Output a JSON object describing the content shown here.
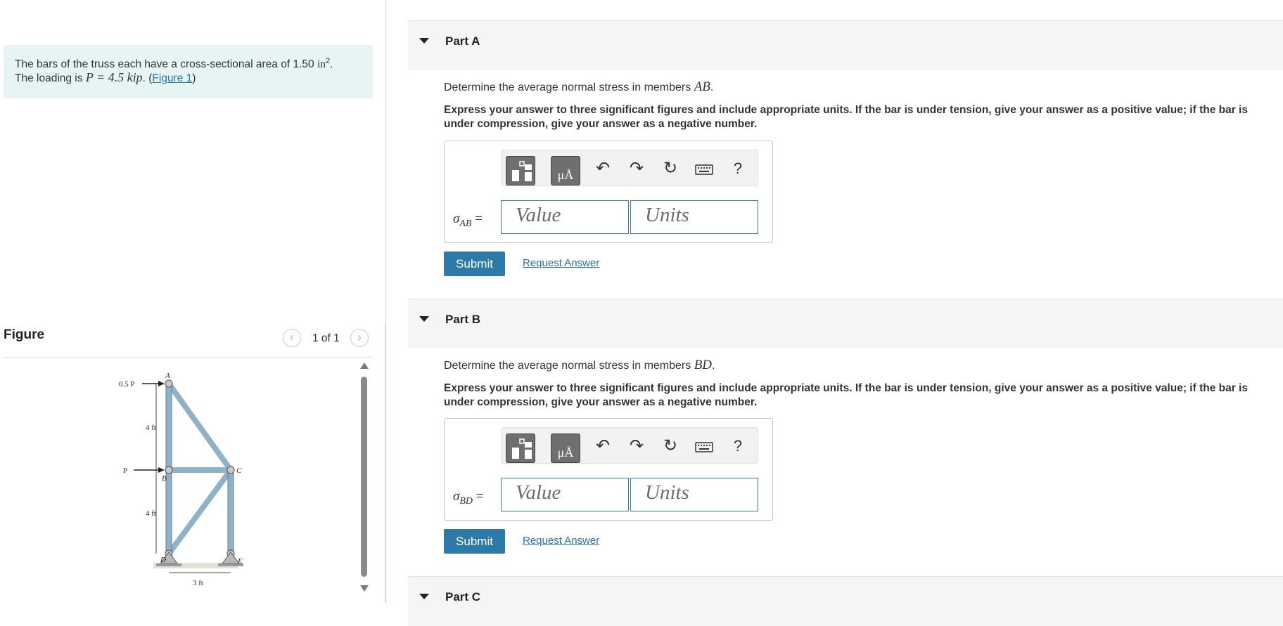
{
  "problem": {
    "text_before": "The bars of the truss each have a cross-sectional area of 1.50 ",
    "area_unit": "in",
    "area_exp": "2",
    "period": ".",
    "loading_prefix": "The loading is ",
    "load_eq": "P = 4.5 kip",
    "after_eq": ". (",
    "figure_link": "Figure 1",
    "close": ")"
  },
  "figure": {
    "title": "Figure",
    "page_indicator": "1 of 1",
    "prev_icon": "chevron-left-icon",
    "next_icon": "chevron-right-icon",
    "labels": {
      "load_top": "0.5 P",
      "load_mid": "P",
      "node_a": "A",
      "node_b": "B",
      "node_c": "C",
      "node_d": "D",
      "node_e": "E",
      "dim_upper": "4 ft",
      "dim_lower": "4 ft",
      "dim_width": "3 ft"
    }
  },
  "toolbar": {
    "templates_icon": "templates-icon",
    "units_label": "μÅ",
    "undo_icon": "undo-icon",
    "redo_icon": "redo-icon",
    "reset_icon": "reset-icon",
    "keyboard_icon": "keyboard-icon",
    "help_label": "?"
  },
  "parts": [
    {
      "title": "Part A",
      "question_prefix": "Determine the average normal stress in members ",
      "member": "AB",
      "question_suffix": ".",
      "instruction": "Express your answer to three significant figures and include appropriate units. If the bar is under tension, give your answer as a positive value; if the bar is under compression, give your answer as a negative number.",
      "sigma": "σ",
      "sigma_sub": "AB",
      "equals": " =",
      "value_placeholder": "Value",
      "units_placeholder": "Units",
      "submit_label": "Submit",
      "request_label": "Request Answer"
    },
    {
      "title": "Part B",
      "question_prefix": "Determine the average normal stress in members ",
      "member": "BD",
      "question_suffix": ".",
      "instruction": "Express your answer to three significant figures and include appropriate units. If the bar is under tension, give your answer as a positive value; if the bar is under compression, give your answer as a negative number.",
      "sigma": "σ",
      "sigma_sub": "BD",
      "equals": " =",
      "value_placeholder": "Value",
      "units_placeholder": "Units",
      "submit_label": "Submit",
      "request_label": "Request Answer"
    },
    {
      "title": "Part C"
    }
  ]
}
